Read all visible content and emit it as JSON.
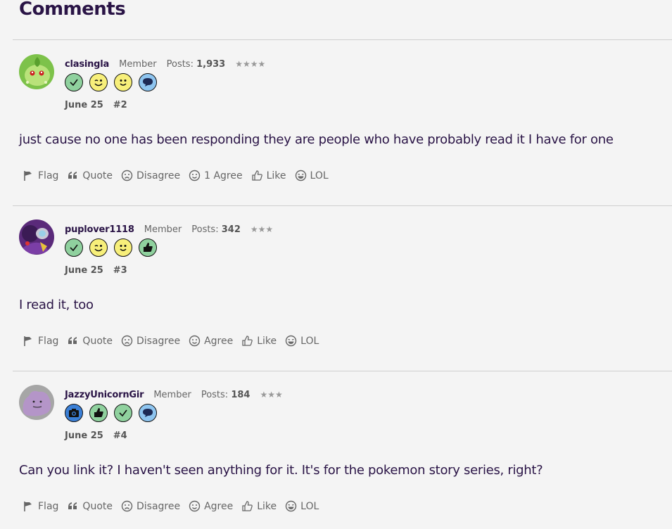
{
  "page": {
    "title": "Comments"
  },
  "action_labels": {
    "flag": "Flag",
    "quote": "Quote",
    "disagree": "Disagree",
    "like": "Like",
    "lol": "LOL"
  },
  "comments": [
    {
      "username": "clasingla",
      "role": "Member",
      "posts_label": "Posts:",
      "posts": "1,933",
      "stars": "★★★★",
      "badges": [
        "check-icon",
        "wink-icon",
        "smile-icon",
        "speech-bubble-icon"
      ],
      "date": "June 25",
      "number": "#2",
      "body": "just cause no one has been responding they are people who have probably read it I have for one",
      "agree_label": "1 Agree"
    },
    {
      "username": "puplover1118",
      "role": "Member",
      "posts_label": "Posts:",
      "posts": "342",
      "stars": "★★★",
      "badges": [
        "check-icon",
        "wink-icon",
        "smile-icon",
        "thumbs-up-icon"
      ],
      "date": "June 25",
      "number": "#3",
      "body": "I read it, too",
      "agree_label": "Agree"
    },
    {
      "username": "JazzyUnicornGir",
      "role": "Member",
      "posts_label": "Posts:",
      "posts": "184",
      "stars": "★★★",
      "badges": [
        "camera-icon",
        "thumbs-up-icon",
        "check-icon",
        "speech-bubble-icon"
      ],
      "date": "June 25",
      "number": "#4",
      "body": "Can you link it? I haven't seen anything for it. It's for the pokemon story series, right?",
      "agree_label": "Agree"
    }
  ],
  "colors": {
    "title": "#2a1446",
    "muted": "#666666",
    "badge_green": "#8fd19e",
    "badge_yellow": "#f7ef7a",
    "badge_blue": "#8ec5f0",
    "badge_camera": "#3a7fd6"
  }
}
